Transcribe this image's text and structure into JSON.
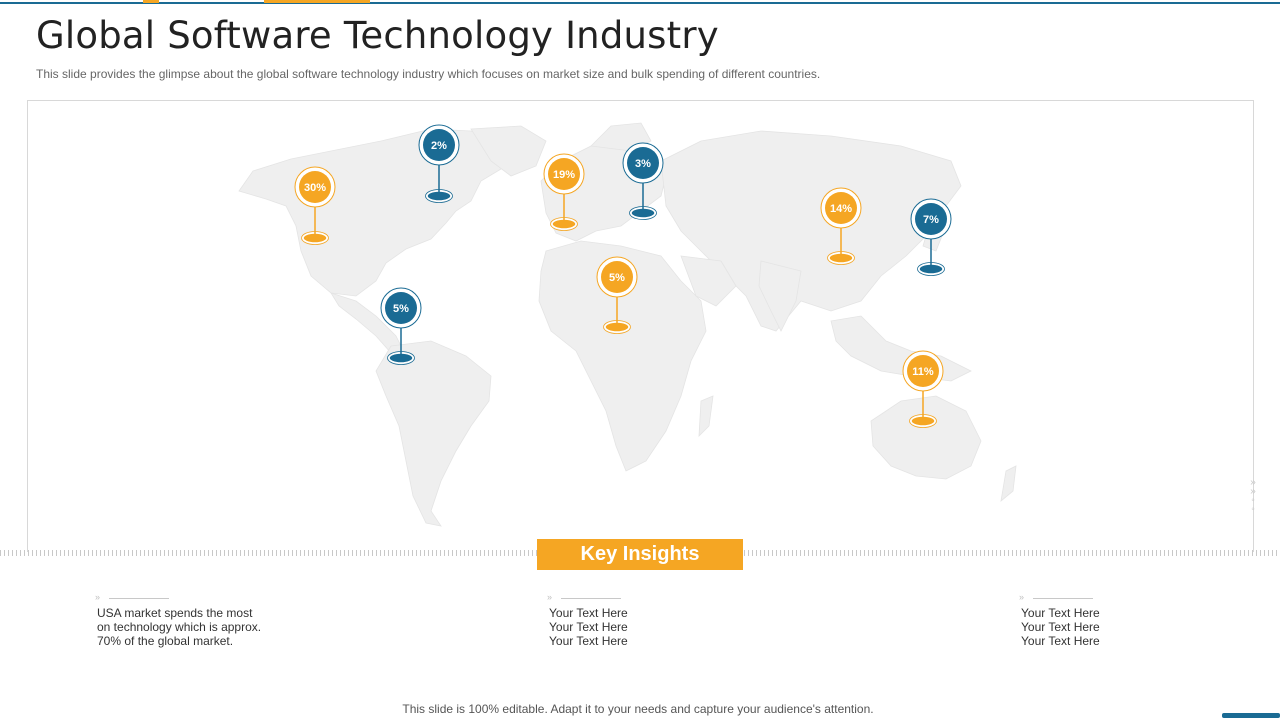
{
  "title": "Global Software Technology Industry",
  "subtitle": "This slide provides  the glimpse about the global software  technology industry which focuses on market size and bulk spending of different  countries.",
  "colors": {
    "accent_orange": "#f5a623",
    "accent_blue": "#1a6b94",
    "map_land": "#efefef"
  },
  "map": {
    "pins": [
      {
        "label": "30%",
        "color": "orange"
      },
      {
        "label": "2%",
        "color": "blue"
      },
      {
        "label": "19%",
        "color": "orange"
      },
      {
        "label": "3%",
        "color": "blue"
      },
      {
        "label": "14%",
        "color": "orange"
      },
      {
        "label": "7%",
        "color": "blue"
      },
      {
        "label": "5%",
        "color": "orange"
      },
      {
        "label": "5%",
        "color": "blue"
      },
      {
        "label": "11%",
        "color": "orange"
      }
    ]
  },
  "key_insights": {
    "title": "Key Insights",
    "columns": [
      {
        "lines": [
          "USA market spends the most",
          "on technology which is approx.",
          "70% of the global market."
        ]
      },
      {
        "lines": [
          "Your Text Here",
          "Your Text Here",
          "Your Text Here"
        ]
      },
      {
        "lines": [
          "Your Text Here",
          "Your Text Here",
          "Your Text Here"
        ]
      }
    ]
  },
  "footer": "This slide is 100% editable. Adapt it to your needs and capture your audience's attention."
}
